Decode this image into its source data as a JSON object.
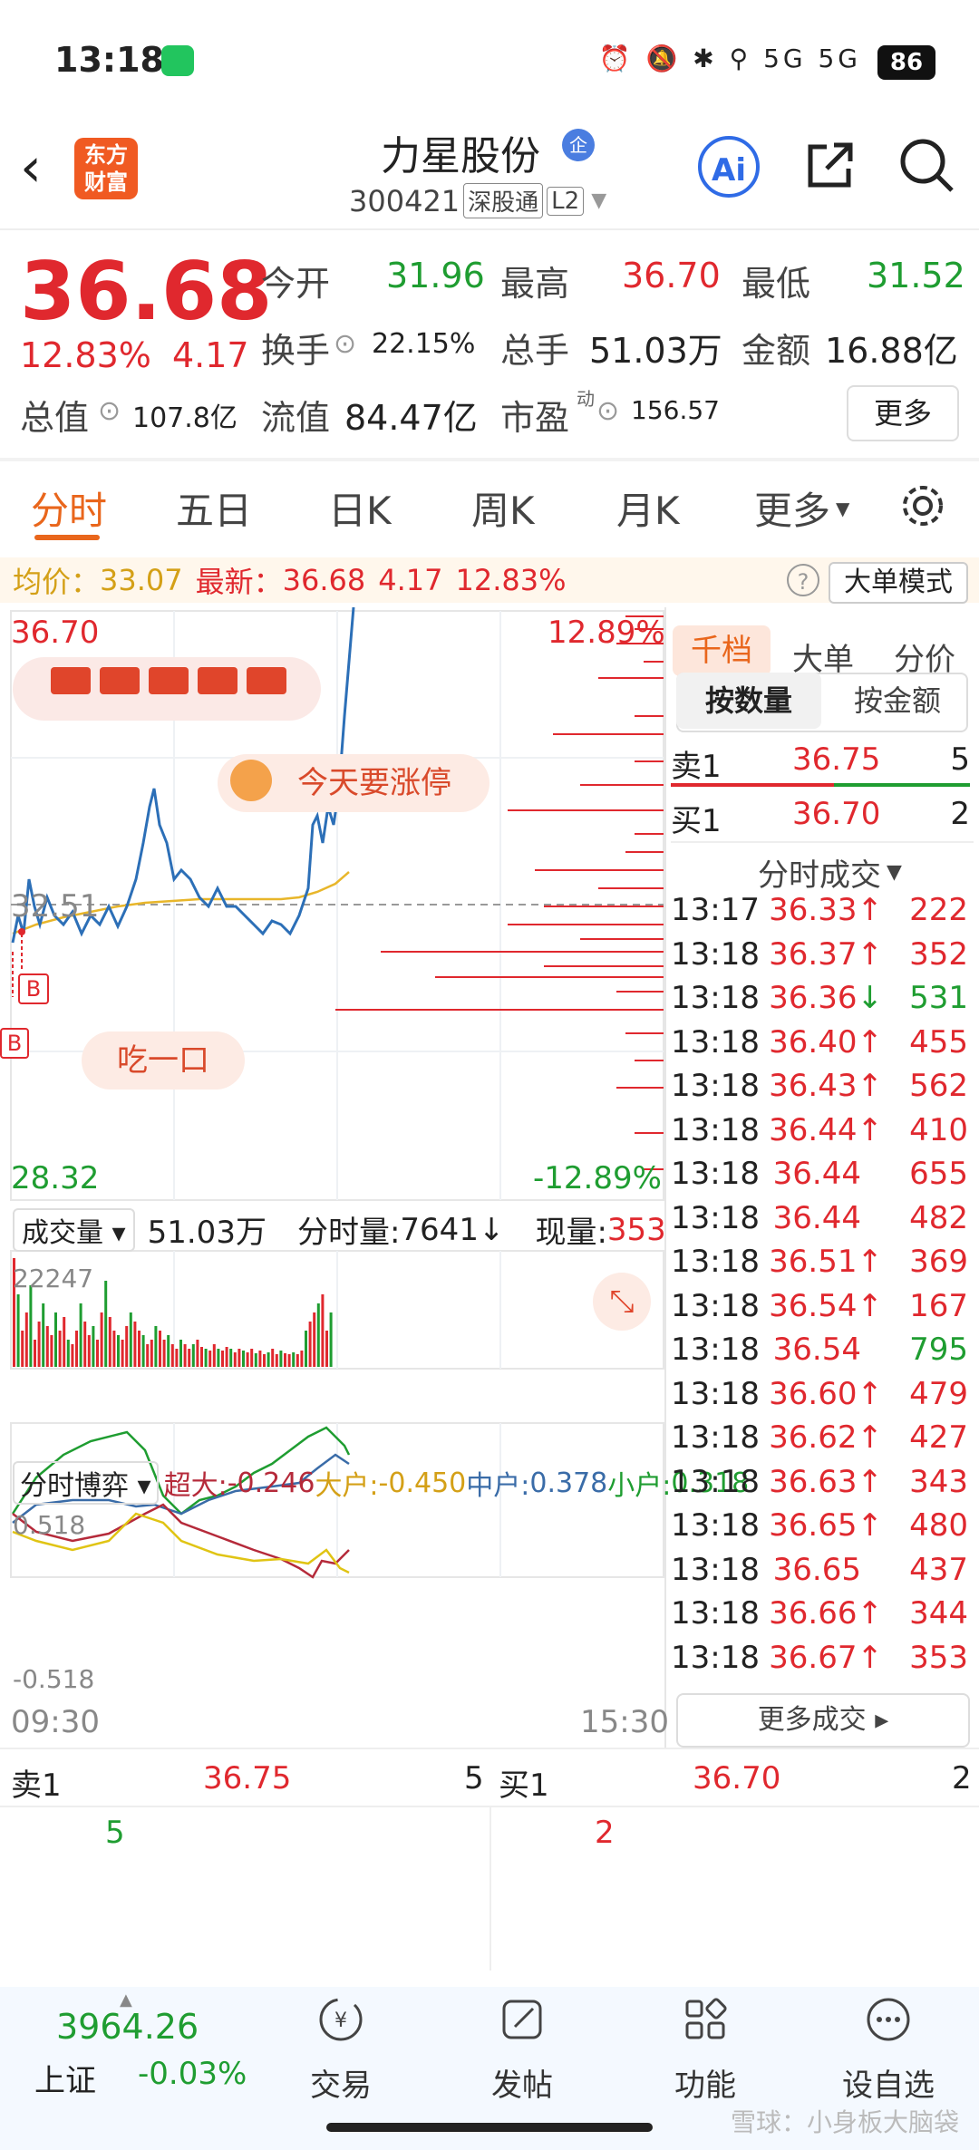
{
  "status_bar": {
    "time": "13:18",
    "icons": "⏰ 🔕 ✱ ⚲ 5G 5G",
    "battery": "86"
  },
  "header": {
    "logo_text": "东方财富",
    "stock_name": "力星股份",
    "ent_badge": "企",
    "stock_code": "300421",
    "tag_connect": "深股通",
    "tag_level": "L2"
  },
  "quote": {
    "price": "36.68",
    "change_pct": "12.83%",
    "change_abs": "4.17",
    "open_label": "今开",
    "open": "31.96",
    "high_label": "最高",
    "high": "36.70",
    "low_label": "最低",
    "low": "31.52",
    "turnover_label": "换手",
    "turnover": "22.15%",
    "volume_label": "总手",
    "volume": "51.03万",
    "amount_label": "金额",
    "amount": "16.88亿",
    "mktcap_label": "总值",
    "mktcap": "107.8亿",
    "float_label": "流值",
    "float": "84.47亿",
    "pe_label": "市盈",
    "pe_sup": "动",
    "pe": "156.57",
    "more": "更多"
  },
  "tabs": [
    "分时",
    "五日",
    "日K",
    "周K",
    "月K",
    "更多"
  ],
  "avg_bar": {
    "avg_label": "均价：",
    "avg": "33.07",
    "latest_label": "最新：",
    "latest": "36.68",
    "latest_chg": "4.17",
    "latest_pct": "12.83%",
    "big_order_mode": "大单模式"
  },
  "chart": {
    "top_price": "36.70",
    "top_pct": "12.89%",
    "mid_price": "32.51",
    "bottom_price": "28.32",
    "bottom_pct": "-12.89%",
    "bubble_limit_up": "今天要涨停",
    "bubble_eat": "吃一口",
    "marker_b": "B",
    "volume_label": "成交量",
    "volume_total": "51.03万",
    "tick_volume_label": "分时量:",
    "tick_volume": "7641",
    "current_volume_label": "现量:",
    "current_volume": "353",
    "volume_max": "22247",
    "game_label": "分时博弈",
    "super_label": "超大:",
    "super": "-0.246",
    "large_label": "大户:",
    "large": "-0.450",
    "mid_label": "中户:",
    "mid": "0.378",
    "small_label": "小户:",
    "small": "0.318",
    "game_top": "0.518",
    "game_bottom": "-0.518",
    "time_start": "09:30",
    "time_end": "15:30"
  },
  "right_panel": {
    "tabs": [
      "千档",
      "大单",
      "分价"
    ],
    "seg_qty": "按数量",
    "seg_amount": "按金额",
    "sell1_label": "卖1",
    "sell1_price": "36.75",
    "sell1_qty": "5",
    "buy1_label": "买1",
    "buy1_price": "36.70",
    "buy1_qty": "2",
    "ticks_title": "分时成交",
    "ticks": [
      {
        "time": "13:17",
        "price": "36.33",
        "dir": "↑",
        "vol": "222",
        "color": "red"
      },
      {
        "time": "13:18",
        "price": "36.37",
        "dir": "↑",
        "vol": "352",
        "color": "red"
      },
      {
        "time": "13:18",
        "price": "36.36",
        "dir": "↓",
        "vol": "531",
        "color": "green"
      },
      {
        "time": "13:18",
        "price": "36.40",
        "dir": "↑",
        "vol": "455",
        "color": "red"
      },
      {
        "time": "13:18",
        "price": "36.43",
        "dir": "↑",
        "vol": "562",
        "color": "red"
      },
      {
        "time": "13:18",
        "price": "36.44",
        "dir": "↑",
        "vol": "410",
        "color": "red"
      },
      {
        "time": "13:18",
        "price": "36.44",
        "dir": "",
        "vol": "655",
        "color": "red"
      },
      {
        "time": "13:18",
        "price": "36.44",
        "dir": "",
        "vol": "482",
        "color": "red"
      },
      {
        "time": "13:18",
        "price": "36.51",
        "dir": "↑",
        "vol": "369",
        "color": "red"
      },
      {
        "time": "13:18",
        "price": "36.54",
        "dir": "↑",
        "vol": "167",
        "color": "red"
      },
      {
        "time": "13:18",
        "price": "36.54",
        "dir": "",
        "vol": "795",
        "color": "green"
      },
      {
        "time": "13:18",
        "price": "36.60",
        "dir": "↑",
        "vol": "479",
        "color": "red"
      },
      {
        "time": "13:18",
        "price": "36.62",
        "dir": "↑",
        "vol": "427",
        "color": "red"
      },
      {
        "time": "13:18",
        "price": "36.63",
        "dir": "↑",
        "vol": "343",
        "color": "red"
      },
      {
        "time": "13:18",
        "price": "36.65",
        "dir": "↑",
        "vol": "480",
        "color": "red"
      },
      {
        "time": "13:18",
        "price": "36.65",
        "dir": "",
        "vol": "437",
        "color": "red"
      },
      {
        "time": "13:18",
        "price": "36.66",
        "dir": "↑",
        "vol": "344",
        "color": "red"
      },
      {
        "time": "13:18",
        "price": "36.67",
        "dir": "↑",
        "vol": "353",
        "color": "red"
      }
    ],
    "more_ticks": "更多成交 ▸"
  },
  "bottom_orderbook": {
    "sell1_label": "卖1",
    "sell1_price": "36.75",
    "sell1_qty": "5",
    "buy1_label": "买1",
    "buy1_price": "36.70",
    "buy1_qty": "2",
    "sell_detail": "5",
    "buy_detail": "2"
  },
  "navbar": {
    "index_value": "3964.26",
    "index_name": "上证",
    "index_change": "-0.03%",
    "items": [
      "交易",
      "发帖",
      "功能",
      "设自选"
    ]
  },
  "watermark": "雪球：小身板大脑袋",
  "colors": {
    "up": "#e0282e",
    "down": "#1f9d31",
    "accent": "#e9661c",
    "blue": "#2f6be6"
  }
}
